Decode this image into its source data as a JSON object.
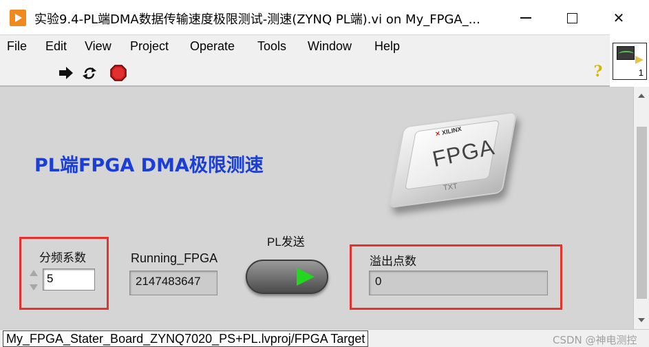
{
  "window": {
    "title": "实验9.4-PL端DMA数据传输速度极限测试-测速(ZYNQ PL端).vi on My_FPGA_...",
    "minimize_icon": "minimize-icon",
    "maximize_icon": "maximize-icon",
    "close_icon": "close-icon",
    "close_glyph": "✕"
  },
  "menu": {
    "items": [
      "File",
      "Edit",
      "View",
      "Project",
      "Operate",
      "Tools",
      "Window",
      "Help"
    ]
  },
  "toolbar": {
    "run_icon": "run-arrow-icon",
    "run_continuously_icon": "run-continuously-icon",
    "abort_icon": "abort-execution-icon",
    "help_glyph": "?",
    "connector_number": "1"
  },
  "panel": {
    "heading": "PL端FPGA DMA极限测速",
    "chip": {
      "label": "FPGA",
      "brand": "XILINX",
      "sub": "TXT"
    },
    "divider": {
      "label": "分频系数",
      "value": "5"
    },
    "running_fpga": {
      "label": "Running_FPGA",
      "value": "2147483647"
    },
    "pl_send": {
      "label": "PL发送"
    },
    "overflow": {
      "label": "溢出点数",
      "value": "0"
    },
    "highlight_color": "#e8312d",
    "heading_color": "#1a3fd6"
  },
  "status": {
    "path": "My_FPGA_Stater_Board_ZYNQ7020_PS+PL.lvproj/FPGA Target",
    "watermark": "CSDN @神电测控"
  }
}
